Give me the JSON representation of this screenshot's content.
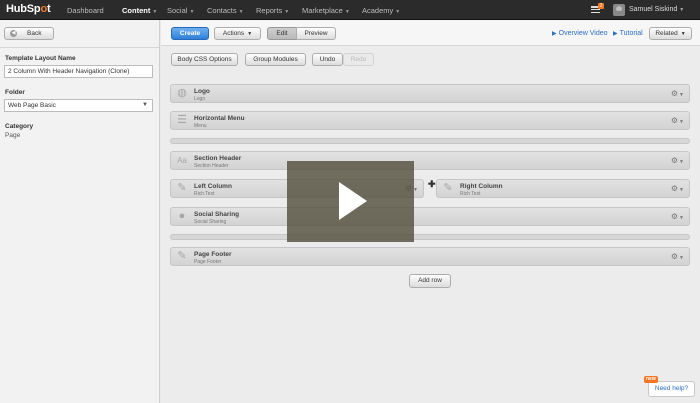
{
  "nav": {
    "logo_pre": "HubSp",
    "logo_o": "o",
    "logo_post": "t",
    "items": [
      "Dashboard",
      "Content",
      "Social",
      "Contacts",
      "Reports",
      "Marketplace",
      "Academy"
    ],
    "active": "Content",
    "notification_count": "2",
    "user_name": "Samuel Siskind"
  },
  "sidebar": {
    "back_label": "Back",
    "template_name_label": "Template Layout Name",
    "template_name_value": "2 Column With Header Navigation (Clone)",
    "folder_label": "Folder",
    "folder_value": "Web Page Basic",
    "category_label": "Category",
    "category_value": "Page"
  },
  "toolbar": {
    "create_label": "Create",
    "actions_label": "Actions",
    "edit_label": "Edit",
    "preview_label": "Preview",
    "overview_video_label": "Overview Video",
    "tutorial_label": "Tutorial",
    "related_label": "Related",
    "body_css_label": "Body CSS Options",
    "group_modules_label": "Group Modules",
    "undo_label": "Undo",
    "redo_label": "Redo"
  },
  "modules": {
    "logo": {
      "title": "Logo",
      "subtitle": "Logo",
      "icon": "globe-icon"
    },
    "menu": {
      "title": "Horizontal Menu",
      "subtitle": "Menu",
      "icon": "menu-icon"
    },
    "section_header": {
      "title": "Section Header",
      "subtitle": "Section Header",
      "icon": "text-icon"
    },
    "left_column": {
      "title": "Left Column",
      "subtitle": "Rich Text",
      "icon": "edit-icon"
    },
    "right_column": {
      "title": "Right Column",
      "subtitle": "Rich Text",
      "icon": "edit-icon"
    },
    "social_sharing": {
      "title": "Social Sharing",
      "subtitle": "Social Sharing",
      "icon": "chat-icon"
    },
    "page_footer": {
      "title": "Page Footer",
      "subtitle": "Page Footer",
      "icon": "edit-icon"
    }
  },
  "add_row_label": "Add row",
  "help": {
    "badge": "new",
    "label": "Need help?"
  }
}
